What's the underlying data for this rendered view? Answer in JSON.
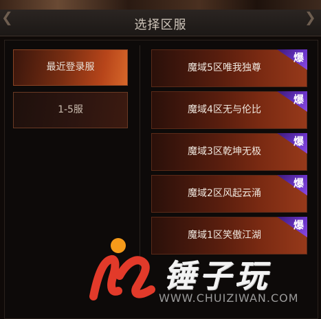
{
  "header": {
    "title": "选择区服"
  },
  "left_menu": [
    {
      "label": "最近登录服",
      "active": true
    },
    {
      "label": "1-5服",
      "active": false
    }
  ],
  "servers": [
    {
      "name": "魔域5区唯我独尊",
      "badge": "爆"
    },
    {
      "name": "魔域4区无与伦比",
      "badge": "爆"
    },
    {
      "name": "魔域3区乾坤无极",
      "badge": "爆"
    },
    {
      "name": "魔域2区风起云涌",
      "badge": "爆"
    },
    {
      "name": "魔域1区笑傲江湖",
      "badge": "爆"
    }
  ],
  "watermark": {
    "brand": "锤子玩",
    "url": "WWW.CHUIZIWAN.COM"
  },
  "colors": {
    "badge": "#6a34c8",
    "accent": "#d7672a",
    "logo_red": "#e23a2a",
    "logo_orange": "#f59a1a"
  }
}
